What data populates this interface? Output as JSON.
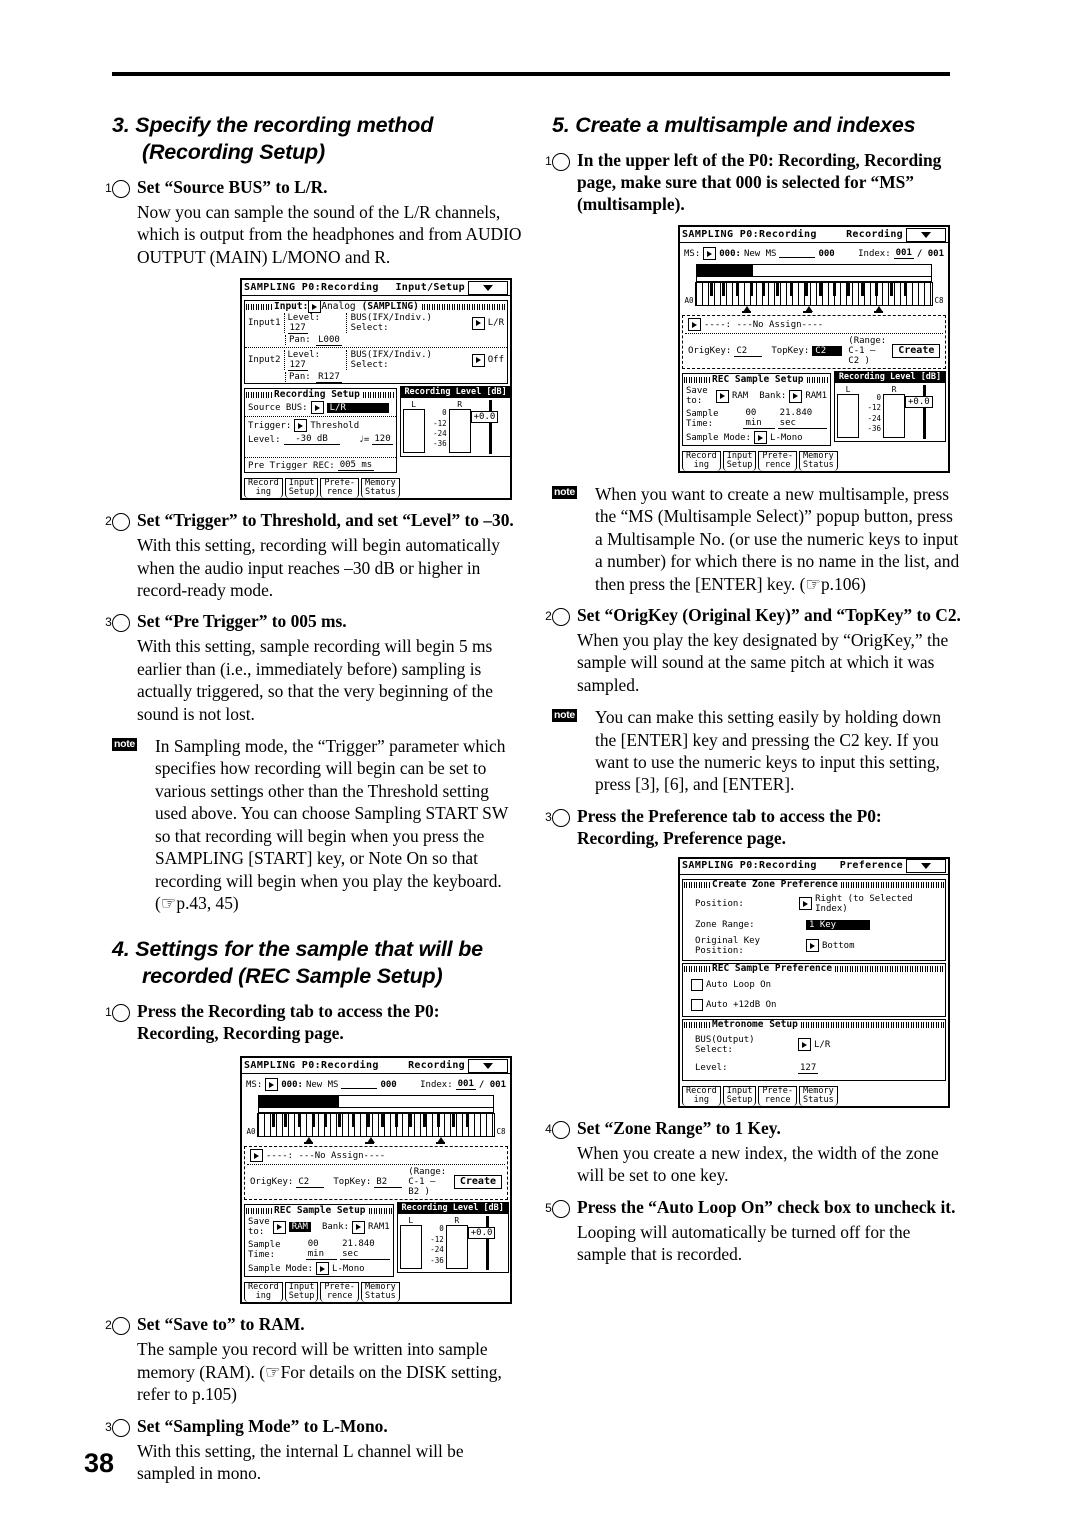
{
  "page_number": "38",
  "left_column": {
    "section3": {
      "heading": "3. Specify the recording method (Recording Setup)",
      "steps": [
        {
          "num": "1",
          "title": "Set “Source BUS” to L/R.",
          "body": "Now you can sample the sound of the L/R channels, which is output from the headphones and from AUDIO OUTPUT (MAIN) L/MONO and R."
        },
        {
          "num": "2",
          "title": "Set “Trigger” to Threshold, and set “Level” to –30.",
          "body": "With this setting, recording will begin automatically when the audio input reaches –30 dB or higher in record-ready mode."
        },
        {
          "num": "3",
          "title": "Set “Pre Trigger” to 005 ms.",
          "body": "With this setting, sample recording will begin 5 ms earlier than (i.e., immediately before) sampling is actually triggered, so that the very beginning of the sound is not lost."
        }
      ],
      "note": "In Sampling mode, the “Trigger” parameter which specifies how recording will begin can be set to various settings other than the Threshold setting used above. You can choose Sampling START SW so that recording will begin when you press the SAMPLING [START] key, or Note On so that recording will begin when you play the keyboard. (☞p.43, 45)"
    },
    "section4": {
      "heading": "4. Settings for the sample that will be recorded (REC Sample Setup)",
      "steps": [
        {
          "num": "1",
          "title": "Press the Recording tab to access the P0: Recording, Recording page.",
          "body": ""
        },
        {
          "num": "2",
          "title": "Set “Save to” to RAM.",
          "body": "The sample you record will be written into sample memory (RAM). (☞For details on the DISK setting, refer to p.105)"
        },
        {
          "num": "3",
          "title": "Set “Sampling Mode” to L-Mono.",
          "body": "With this setting, the internal L channel will be sampled in mono."
        }
      ]
    }
  },
  "right_column": {
    "section5": {
      "heading": "5. Create a multisample and indexes",
      "steps": [
        {
          "num": "1",
          "title": "In the upper left of the P0: Recording, Recording page, make sure that 000 is selected for “MS” (multisample).",
          "body": ""
        },
        {
          "num": "2",
          "title": "Set “OrigKey (Original Key)” and “TopKey” to C2.",
          "body": "When you play the key designated by “OrigKey,” the sample will sound at the same pitch at which it was sampled."
        },
        {
          "num": "3",
          "title": "Press the Preference tab to access the P0: Recording, Preference page.",
          "body": ""
        },
        {
          "num": "4",
          "title": "Set “Zone Range” to 1 Key.",
          "body": "When you create a new index, the width of the zone will be set to one key."
        },
        {
          "num": "5",
          "title": "Press the “Auto Loop On” check box to uncheck it.",
          "body": "Looping will automatically be turned off for the sample that is recorded."
        }
      ],
      "note1": "When you want to create a new multisample, press the “MS (Multisample Select)” popup button, press a Multisample No. (or use the numeric keys to input a number) for which there is no name in the list, and then press the [ENTER] key. (☞p.106)",
      "note2": "You can make this setting easily by holding down the [ENTER] key and pressing the C2 key. If you want to use the numeric keys to input this setting, press [3], [6], and [ENTER]."
    }
  },
  "lcd_input_setup": {
    "title_left": "SAMPLING P0:Recording",
    "title_right": "Input/Setup",
    "input_group": {
      "label": "Input:",
      "value": "Analog",
      "mode": "(SAMPLING)"
    },
    "input1": {
      "name": "Input1",
      "level_label": "Level:",
      "level_value": "127",
      "pan_label": "Pan:",
      "pan_value": "L000",
      "bus_label": "BUS(IFX/Indiv.) Select:",
      "bus_value": "L/R"
    },
    "input2": {
      "name": "Input2",
      "level_label": "Level:",
      "level_value": "127",
      "pan_label": "Pan:",
      "pan_value": "R127",
      "bus_label": "BUS(IFX/Indiv.) Select:",
      "bus_value": "Off"
    },
    "recording_setup": {
      "header": "Recording Setup",
      "source_bus_label": "Source BUS:",
      "source_bus_value": "L/R",
      "trigger_label": "Trigger:",
      "trigger_value": "Threshold",
      "level_label": "Level:",
      "level_value": "-30 dB",
      "tempo_label": "♩=",
      "tempo_value": "120",
      "pretrigger_label": "Pre Trigger REC:",
      "pretrigger_value": "005 ms"
    },
    "meter": {
      "title": "Recording Level [dB]",
      "left": "L",
      "right": "R",
      "scale": [
        "0",
        "-12",
        "-24",
        "-36"
      ],
      "value": "+0.0"
    },
    "tabs": [
      {
        "l1": "Record",
        "l2": "ing"
      },
      {
        "l1": "Input",
        "l2": "Setup"
      },
      {
        "l1": "Prefe-",
        "l2": "rence"
      },
      {
        "l1": "Memory",
        "l2": "Status"
      }
    ]
  },
  "lcd_recording_b2": {
    "title_left": "SAMPLING P0:Recording",
    "title_right": "Recording",
    "ms_label": "MS:",
    "ms_num": "000:",
    "ms_name": "New MS",
    "ms_suffix": "000",
    "index_label": "Index:",
    "index_value": "001",
    "index_total": "/ 001",
    "kbd_low": "A0",
    "kbd_high": "C8",
    "assign": "----: ---No Assign----",
    "origkey_label": "OrigKey:",
    "origkey_value": "C2",
    "topkey_label": "TopKey:",
    "topkey_value": "B2",
    "range_text": "(Range: C-1 – B2  )",
    "create_btn": "Create",
    "rec_sample_setup": {
      "header": "REC Sample Setup",
      "saveto_label": "Save to:",
      "saveto_value": "RAM",
      "bank_label": "Bank:",
      "bank_value": "RAM1",
      "sample_time_label": "Sample Time:",
      "sample_time_min": "00 min",
      "sample_time_sec": "21.840 sec",
      "sample_mode_label": "Sample Mode:",
      "sample_mode_value": "L-Mono"
    },
    "meter": {
      "title": "Recording Level [dB]",
      "left": "L",
      "right": "R",
      "scale": [
        "0",
        "-12",
        "-24",
        "-36"
      ],
      "value": "+0.0"
    },
    "tabs": [
      {
        "l1": "Record",
        "l2": "ing"
      },
      {
        "l1": "Input",
        "l2": "Setup"
      },
      {
        "l1": "Prefe-",
        "l2": "rence"
      },
      {
        "l1": "Memory",
        "l2": "Status"
      }
    ]
  },
  "lcd_recording_r1": {
    "title_left": "SAMPLING P0:Recording",
    "title_right": "Recording",
    "ms_label": "MS:",
    "ms_num": "000:",
    "ms_name": "New MS",
    "ms_suffix": "000",
    "index_label": "Index:",
    "index_value": "001",
    "index_total": "/ 001",
    "kbd_low": "A0",
    "kbd_high": "C8",
    "assign": "----: ---No Assign----",
    "origkey_label": "OrigKey:",
    "origkey_value": "C2",
    "topkey_label": "TopKey:",
    "topkey_value": "C2",
    "range_text": "(Range: C-1 – C2  )",
    "create_btn": "Create",
    "rec_sample_setup": {
      "header": "REC Sample Setup",
      "saveto_label": "Save to:",
      "saveto_value": "RAM",
      "bank_label": "Bank:",
      "bank_value": "RAM1",
      "sample_time_label": "Sample Time:",
      "sample_time_min": "00 min",
      "sample_time_sec": "21.840 sec",
      "sample_mode_label": "Sample Mode:",
      "sample_mode_value": "L-Mono"
    },
    "meter": {
      "title": "Recording Level [dB]",
      "left": "L",
      "right": "R",
      "scale": [
        "0",
        "-12",
        "-24",
        "-36"
      ],
      "value": "+0.0"
    },
    "tabs": [
      {
        "l1": "Record",
        "l2": "ing"
      },
      {
        "l1": "Input",
        "l2": "Setup"
      },
      {
        "l1": "Prefe-",
        "l2": "rence"
      },
      {
        "l1": "Memory",
        "l2": "Status"
      }
    ]
  },
  "lcd_preference": {
    "title_left": "SAMPLING P0:Recording",
    "title_right": "Preference",
    "create_zone": {
      "header": "Create Zone Preference",
      "position_label": "Position:",
      "position_value": "Right (to Selected Index)",
      "zone_range_label": "Zone Range:",
      "zone_range_value": "1 Key",
      "orig_key_pos_label": "Original Key Position:",
      "orig_key_pos_value": "Bottom"
    },
    "rec_sample_pref": {
      "header": "REC Sample Preference",
      "auto_loop_label": "Auto Loop On",
      "auto_12db_label": "Auto +12dB On"
    },
    "metronome": {
      "header": "Metronome Setup",
      "bus_label": "BUS(Output) Select:",
      "bus_value": "L/R",
      "level_label": "Level:",
      "level_value": "127"
    },
    "tabs": [
      {
        "l1": "Record",
        "l2": "ing"
      },
      {
        "l1": "Input",
        "l2": "Setup"
      },
      {
        "l1": "Prefe-",
        "l2": "rence"
      },
      {
        "l1": "Memory",
        "l2": "Status"
      }
    ]
  }
}
